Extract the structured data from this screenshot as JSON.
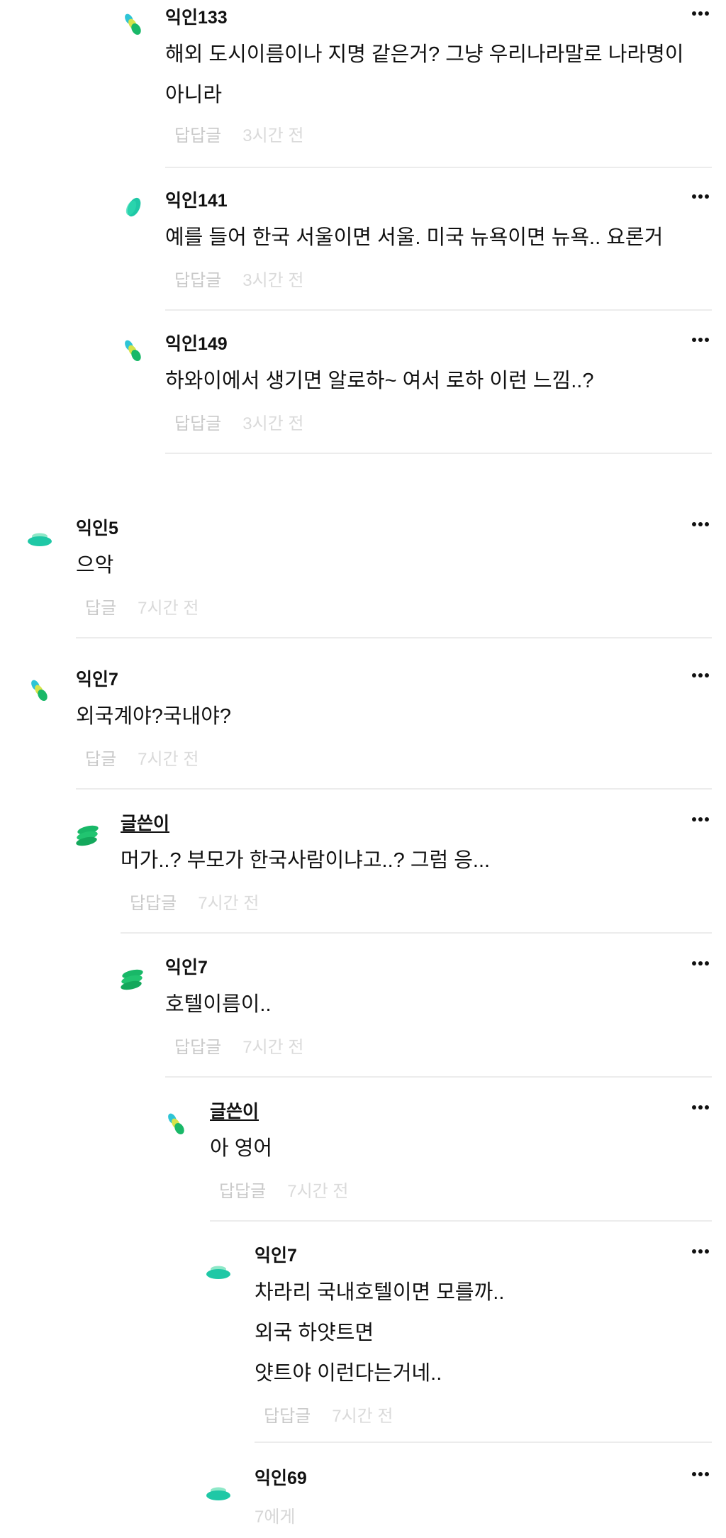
{
  "ui": {
    "more_icon": "more-horizontal-icon",
    "colors": {
      "text": "#111111",
      "meta": "#c9c9c9",
      "divider": "#ececec",
      "avatar_teal": "#1fc8a6",
      "avatar_green": "#19b868",
      "avatar_yellow": "#d6e34a",
      "avatar_cyan": "#2ec4d6"
    }
  },
  "comments": [
    {
      "name": "익인133",
      "lines": [
        "해외 도시이름이나 지명 같은거? 그냥 우리나라말로 나라명이",
        "아니라"
      ],
      "reply_label": "답답글",
      "time": "3시간 전",
      "avatar": "mixed-leaves-avatar"
    },
    {
      "name": "익인141",
      "lines": [
        "예를 들어 한국 서울이면 서울. 미국 뉴욕이면 뉴욕.. 요론거"
      ],
      "reply_label": "답답글",
      "time": "3시간 전",
      "avatar": "single-leaf-avatar"
    },
    {
      "name": "익인149",
      "lines": [
        "하와이에서 생기면 알로하~ 여서 로하 이런 느낌..?"
      ],
      "reply_label": "답답글",
      "time": "3시간 전",
      "avatar": "mixed-leaves-avatar"
    },
    {
      "name": "익인5",
      "lines": [
        "으악"
      ],
      "reply_label": "답글",
      "time": "7시간 전",
      "avatar": "disc-stack-avatar"
    },
    {
      "name": "익인7",
      "lines": [
        "외국계야?국내야?"
      ],
      "reply_label": "답글",
      "time": "7시간 전",
      "avatar": "mixed-leaves-avatar"
    },
    {
      "name": "글쓴이",
      "lines": [
        "머가..? 부모가 한국사람이냐고..? 그럼 응..."
      ],
      "reply_label": "답답글",
      "time": "7시간 전",
      "avatar": "green-stack-avatar"
    },
    {
      "name": "익인7",
      "lines": [
        "호텔이름이.."
      ],
      "reply_label": "답답글",
      "time": "7시간 전",
      "avatar": "green-stack-avatar"
    },
    {
      "name": "글쓴이",
      "lines": [
        "아 영어"
      ],
      "reply_label": "답답글",
      "time": "7시간 전",
      "avatar": "mixed-leaves-avatar"
    },
    {
      "name": "익인7",
      "lines": [
        "차라리 국내호텔이면 모를까..",
        "외국 하얏트면",
        "얏트야 이런다는거네.."
      ],
      "reply_label": "답답글",
      "time": "7시간 전",
      "avatar": "disc-stack-avatar"
    },
    {
      "name": "익인69",
      "mention": "7에게",
      "avatar": "disc-stack-avatar"
    }
  ]
}
